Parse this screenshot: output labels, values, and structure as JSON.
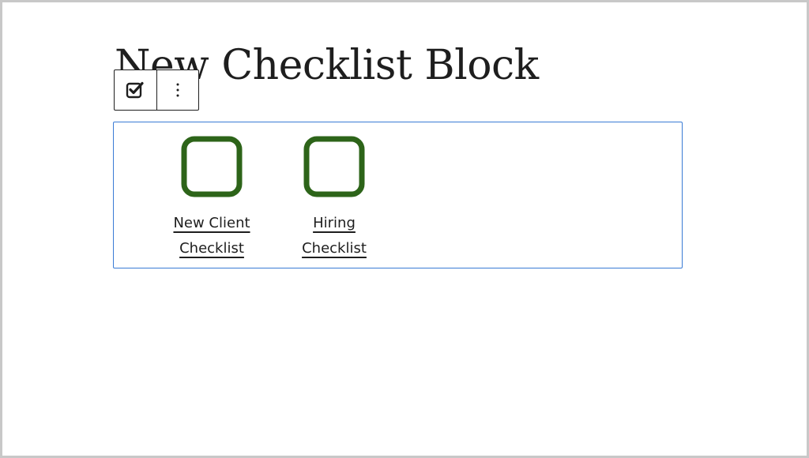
{
  "page": {
    "title": "New Checklist Block"
  },
  "toolbar": {
    "block_type_icon": "checkbox-checked-icon",
    "options_icon": "vertical-ellipsis-icon"
  },
  "checklist": {
    "items": [
      {
        "label": "New Client\nChecklist",
        "checked": false
      },
      {
        "label": "Hiring\nChecklist",
        "checked": false
      }
    ]
  },
  "colors": {
    "checkbox_border": "#2d6419",
    "selection_outline": "#3a7bd5",
    "text": "#1e1e1e"
  }
}
